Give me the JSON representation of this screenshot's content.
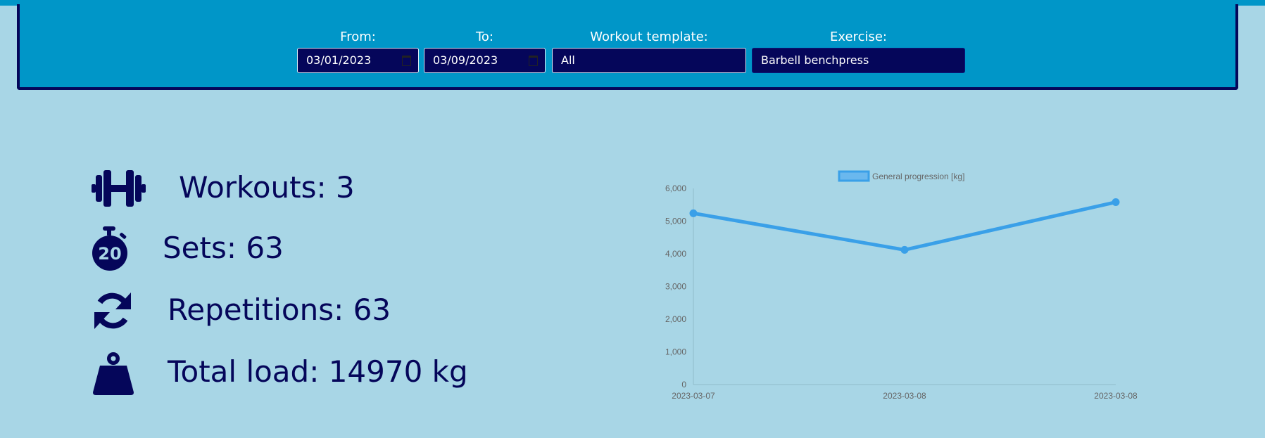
{
  "filters": {
    "from_label": "From:",
    "from_value": "03/01/2023",
    "to_label": "To:",
    "to_value": "03/09/2023",
    "template_label": "Workout template:",
    "template_value": "All",
    "exercise_label": "Exercise:",
    "exercise_value": "Barbell benchpress"
  },
  "stats": {
    "workouts": "Workouts: 3",
    "sets": "Sets: 63",
    "repetitions": "Repetitions: 63",
    "total_load": "Total load: 14970 kg"
  },
  "icons": [
    "dumbbell-icon",
    "stopwatch-20-icon",
    "refresh-icon",
    "weight-icon"
  ],
  "colors": {
    "background": "#a8d6e6",
    "panel": "#0096c8",
    "dark": "#05065a",
    "series": "#3aa0e8"
  },
  "chart_data": {
    "type": "line",
    "x": [
      "2023-03-07",
      "2023-03-08",
      "2023-03-08"
    ],
    "series": [
      {
        "name": "General progression [kg]",
        "values": [
          5240,
          4120,
          5580
        ]
      }
    ],
    "ylim": [
      0,
      6000
    ],
    "yticks": [
      0,
      1000,
      2000,
      3000,
      4000,
      5000,
      6000
    ],
    "ytick_labels": [
      "0",
      "1,000",
      "2,000",
      "3,000",
      "4,000",
      "5,000",
      "6,000"
    ],
    "legend_position": "top",
    "grid": false
  }
}
